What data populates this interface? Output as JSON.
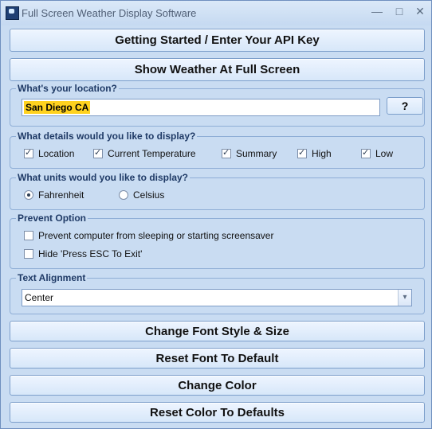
{
  "window": {
    "title": "Full Screen Weather Display Software",
    "controls": {
      "minimize": "—",
      "maximize": "□",
      "close": "✕"
    }
  },
  "buttons": {
    "getting_started": "Getting Started / Enter Your API Key",
    "show_weather": "Show Weather At Full Screen",
    "change_font": "Change Font Style & Size",
    "reset_font": "Reset Font To Default",
    "change_color": "Change Color",
    "reset_color": "Reset Color To Defaults"
  },
  "location_group": {
    "label": "What's your location?",
    "value": "San Diego CA",
    "help_button": "?"
  },
  "details_group": {
    "label": "What details would you like to display?",
    "items": [
      "Location",
      "Current Temperature",
      "Summary",
      "High",
      "Low"
    ],
    "checked": [
      true,
      true,
      true,
      true,
      true
    ]
  },
  "units_group": {
    "label": "What units would you like to display?",
    "options": [
      "Fahrenheit",
      "Celsius"
    ],
    "selected": "Fahrenheit"
  },
  "prevent_group": {
    "label": "Prevent Option",
    "options": [
      "Prevent computer from sleeping or starting screensaver",
      "Hide 'Press ESC To Exit'"
    ],
    "checked": [
      false,
      false
    ]
  },
  "alignment_group": {
    "label": "Text Alignment",
    "selected": "Center"
  }
}
